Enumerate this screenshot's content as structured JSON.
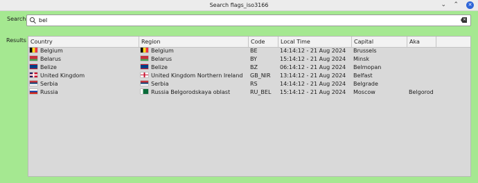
{
  "window": {
    "title": "Search flags_iso3166"
  },
  "search": {
    "label": "Search",
    "value": "bel"
  },
  "results": {
    "label": "Results",
    "columns": [
      "Country",
      "Region",
      "Code",
      "Local Time",
      "Capital",
      "Aka"
    ],
    "rows": [
      {
        "country": "Belgium",
        "country_flag": "belgium-flag",
        "region": "Belgium",
        "region_flag": "belgium-flag",
        "code": "BE",
        "time": "14:14:12 - 21 Aug 2024",
        "capital": "Brussels",
        "aka": ""
      },
      {
        "country": "Belarus",
        "country_flag": "belarus-flag",
        "region": "Belarus",
        "region_flag": "belarus-flag",
        "code": "BY",
        "time": "15:14:12 - 21 Aug 2024",
        "capital": "Minsk",
        "aka": ""
      },
      {
        "country": "Belize",
        "country_flag": "belize-flag",
        "region": "Belize",
        "region_flag": "belize-flag",
        "code": "BZ",
        "time": "06:14:12 - 21 Aug 2024",
        "capital": "Belmopan",
        "aka": ""
      },
      {
        "country": "United Kingdom",
        "country_flag": "uk-flag",
        "region": "United Kingdom Northern Ireland",
        "region_flag": "northern-ireland-flag",
        "code": "GB_NIR",
        "time": "13:14:12 - 21 Aug 2024",
        "capital": "Belfast",
        "aka": ""
      },
      {
        "country": "Serbia",
        "country_flag": "serbia-flag",
        "region": "Serbia",
        "region_flag": "serbia-flag",
        "code": "RS",
        "time": "14:14:12 - 21 Aug 2024",
        "capital": "Belgrade",
        "aka": ""
      },
      {
        "country": "Russia",
        "country_flag": "russia-flag",
        "region": "Russia Belgorodskaya oblast",
        "region_flag": "belgorod-flag",
        "code": "RU_BEL",
        "time": "15:14:12 - 21 Aug 2024",
        "capital": "Moscow",
        "aka": "Belgorod"
      }
    ]
  },
  "colors": {
    "background": "#a5e891",
    "close_button": "#2f66d8"
  }
}
